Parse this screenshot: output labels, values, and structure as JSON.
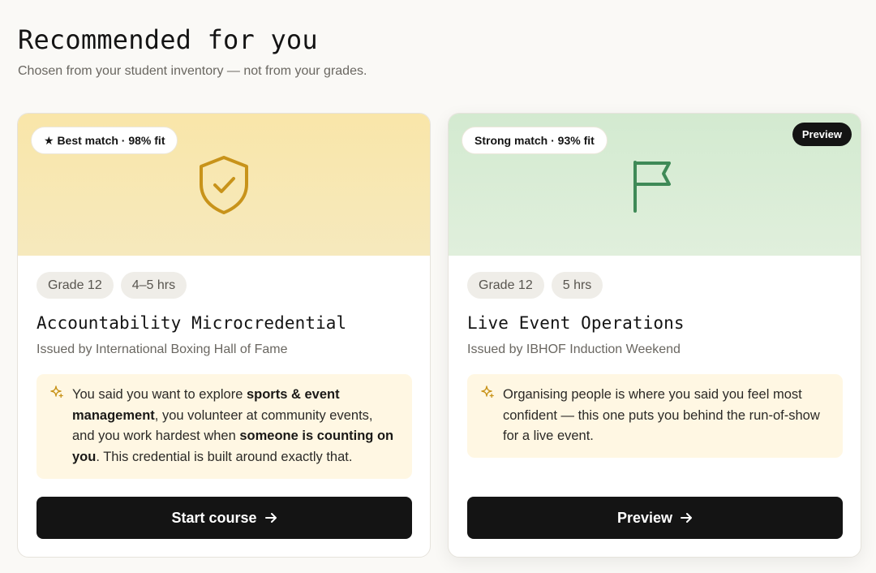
{
  "header": {
    "title": "Recommended for you",
    "subtitle": "Chosen from your student inventory — not from your grades."
  },
  "cards": [
    {
      "match": "★ Best match · 98% fit",
      "icon": "shield-check-icon",
      "accent": "#c8931a",
      "hero_color": "#f8e7b0",
      "tags": [
        "Grade 12",
        "4–5 hrs"
      ],
      "title": "Accountability Microcredential",
      "issuer": "Issued by International Boxing Hall of Fame",
      "reason": {
        "t1": "You said you want to explore ",
        "b1": "sports & event management",
        "t2": ", you volunteer at community events, and you work hardest when ",
        "b2": "someone is counting on you",
        "t3": ". This credential is built around exactly that."
      },
      "cta": "Start course"
    },
    {
      "match": "Strong match · 93% fit",
      "badge": "Preview",
      "icon": "flag-icon",
      "accent": "#3f8a57",
      "hero_color": "#d6ebd2",
      "tags": [
        "Grade 12",
        "5 hrs"
      ],
      "title": "Live Event Operations",
      "issuer": "Issued by IBHOF Induction Weekend",
      "reason": {
        "t1": "Organising people is where you said you feel most confident — this one puts you behind the run-of-show for a live event."
      },
      "cta": "Preview"
    }
  ]
}
